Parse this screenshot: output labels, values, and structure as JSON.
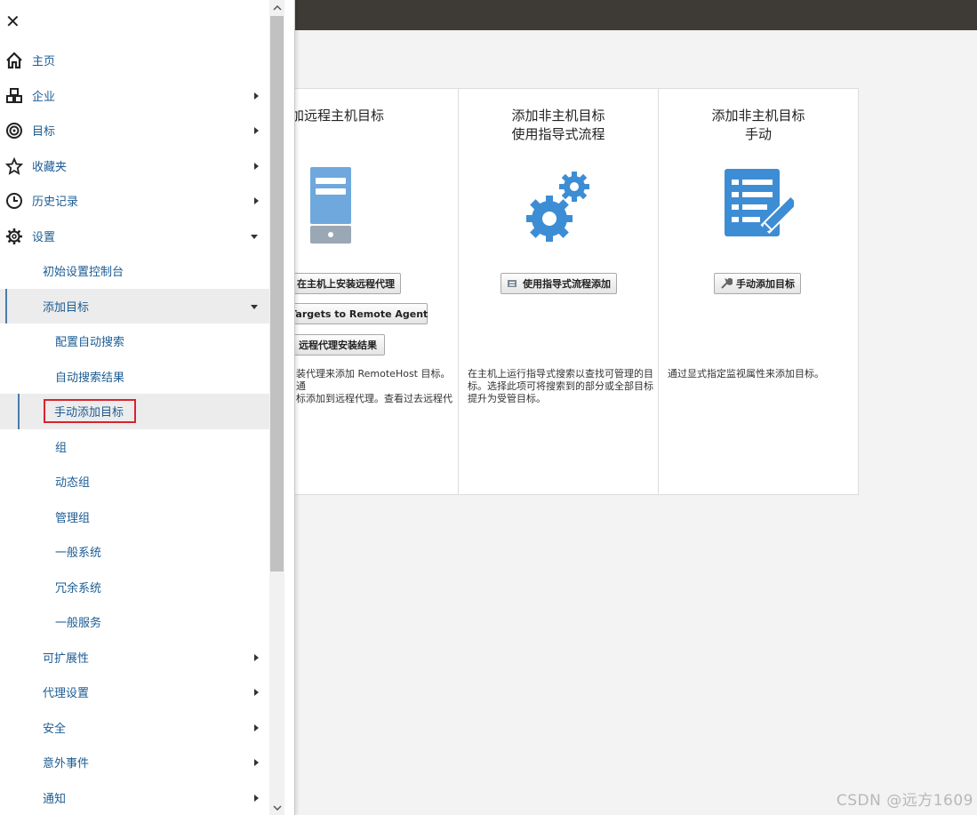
{
  "sidebar": {
    "items": [
      {
        "label": "主页",
        "icon": "home-icon"
      },
      {
        "label": "企业",
        "icon": "enterprise-icon"
      },
      {
        "label": "目标",
        "icon": "target-icon"
      },
      {
        "label": "收藏夹",
        "icon": "star-icon"
      },
      {
        "label": "历史记录",
        "icon": "history-icon"
      },
      {
        "label": "设置",
        "icon": "gear-icon"
      },
      {
        "label": "初始设置控制台"
      },
      {
        "label": "添加目标"
      },
      {
        "label": "配置自动搜索"
      },
      {
        "label": "自动搜索结果"
      },
      {
        "label": "手动添加目标"
      },
      {
        "label": "组"
      },
      {
        "label": "动态组"
      },
      {
        "label": "管理组"
      },
      {
        "label": "一般系统"
      },
      {
        "label": "冗余系统"
      },
      {
        "label": "一般服务"
      },
      {
        "label": "可扩展性"
      },
      {
        "label": "代理设置"
      },
      {
        "label": "安全"
      },
      {
        "label": "意外事件"
      },
      {
        "label": "通知"
      }
    ]
  },
  "cards": {
    "remote": {
      "title": "加远程主机目标",
      "btn1": "在主机上安装远程代理",
      "btn2": "st Targets to Remote Agent",
      "btn3": "远程代理安装结果",
      "desc_line1": "装代理来添加 RemoteHost 目标。通",
      "desc_line2": "标添加到远程代理。查看过去远程代"
    },
    "guided": {
      "title_line1": "添加非主机目标",
      "title_line2": "使用指导式流程",
      "button": "使用指导式流程添加",
      "desc_line1": "在主机上运行指导式搜索以查找可管理的目",
      "desc_line2": "标。选择此项可将搜索到的部分或全部目标",
      "desc_line3": "提升为受管目标。"
    },
    "manual": {
      "title_line1": "添加非主机目标",
      "title_line2": "手动",
      "button": "手动添加目标",
      "desc": "通过显式指定监视属性来添加目标。"
    }
  },
  "colors": {
    "accent": "#3d8dd4",
    "link": "#1c5c93",
    "highlight_box": "#d9232e",
    "topbar": "#3e3b37"
  },
  "watermark": "CSDN @远方1609"
}
